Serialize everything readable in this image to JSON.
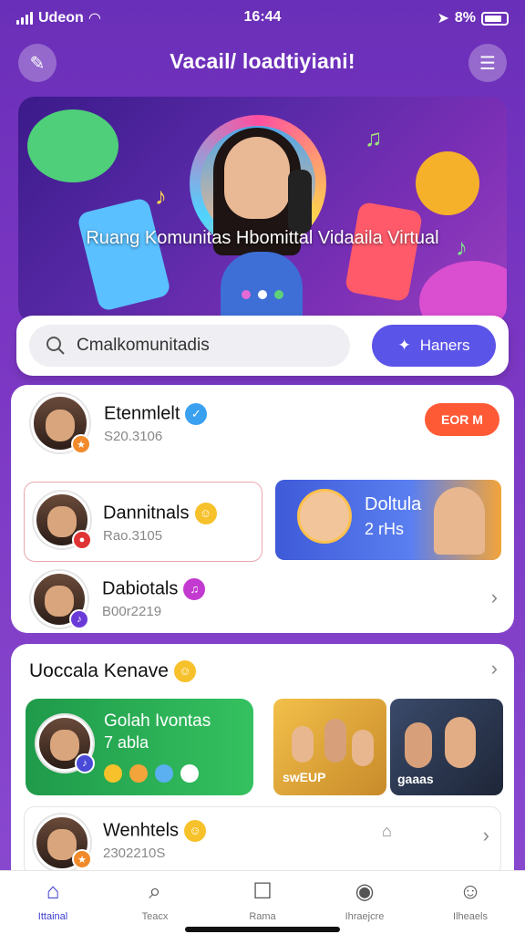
{
  "status_bar": {
    "carrier": "Udeon",
    "time": "16:44",
    "battery": "8%"
  },
  "header": {
    "title": "Vacail/ loadtiyiani!",
    "left_icon": "wand-icon",
    "right_icon": "menu-icon"
  },
  "banner": {
    "caption": "Ruang Komunitas Hbomittal Vidaaila Virtual"
  },
  "search": {
    "placeholder": "Cmalkomunitadis",
    "button_label": "Haners"
  },
  "communities": [
    {
      "name": "Etenmlelt",
      "meta": "S20.3106",
      "action": "EOR M"
    },
    {
      "name": "Dannitnals",
      "meta": "Rao.3105"
    },
    {
      "name": "Dabiotals",
      "meta": "B00r2219"
    }
  ],
  "promo_card": {
    "line1": "Doltula",
    "line2": "2 rHs"
  },
  "section": {
    "title": "Uoccala Kenave"
  },
  "featured": {
    "line1": "Golah Ivontas",
    "line2": "7 abla"
  },
  "thumb_text": {
    "t1": "swEUP",
    "t2": "gaaas"
  },
  "last_item": {
    "name": "Wenhtels",
    "meta": "2302210S"
  },
  "tabs": [
    {
      "label": "Ittainal",
      "icon": "home-icon"
    },
    {
      "label": "Teacx",
      "icon": "search-icon"
    },
    {
      "label": "Rama",
      "icon": "chat-icon"
    },
    {
      "label": "Ihraejcre",
      "icon": "notification-icon"
    },
    {
      "label": "Ilheaels",
      "icon": "profile-icon"
    }
  ],
  "colors": {
    "accent": "#5b54e8",
    "join": "#ff5a36",
    "purple": "#7a36c2"
  }
}
